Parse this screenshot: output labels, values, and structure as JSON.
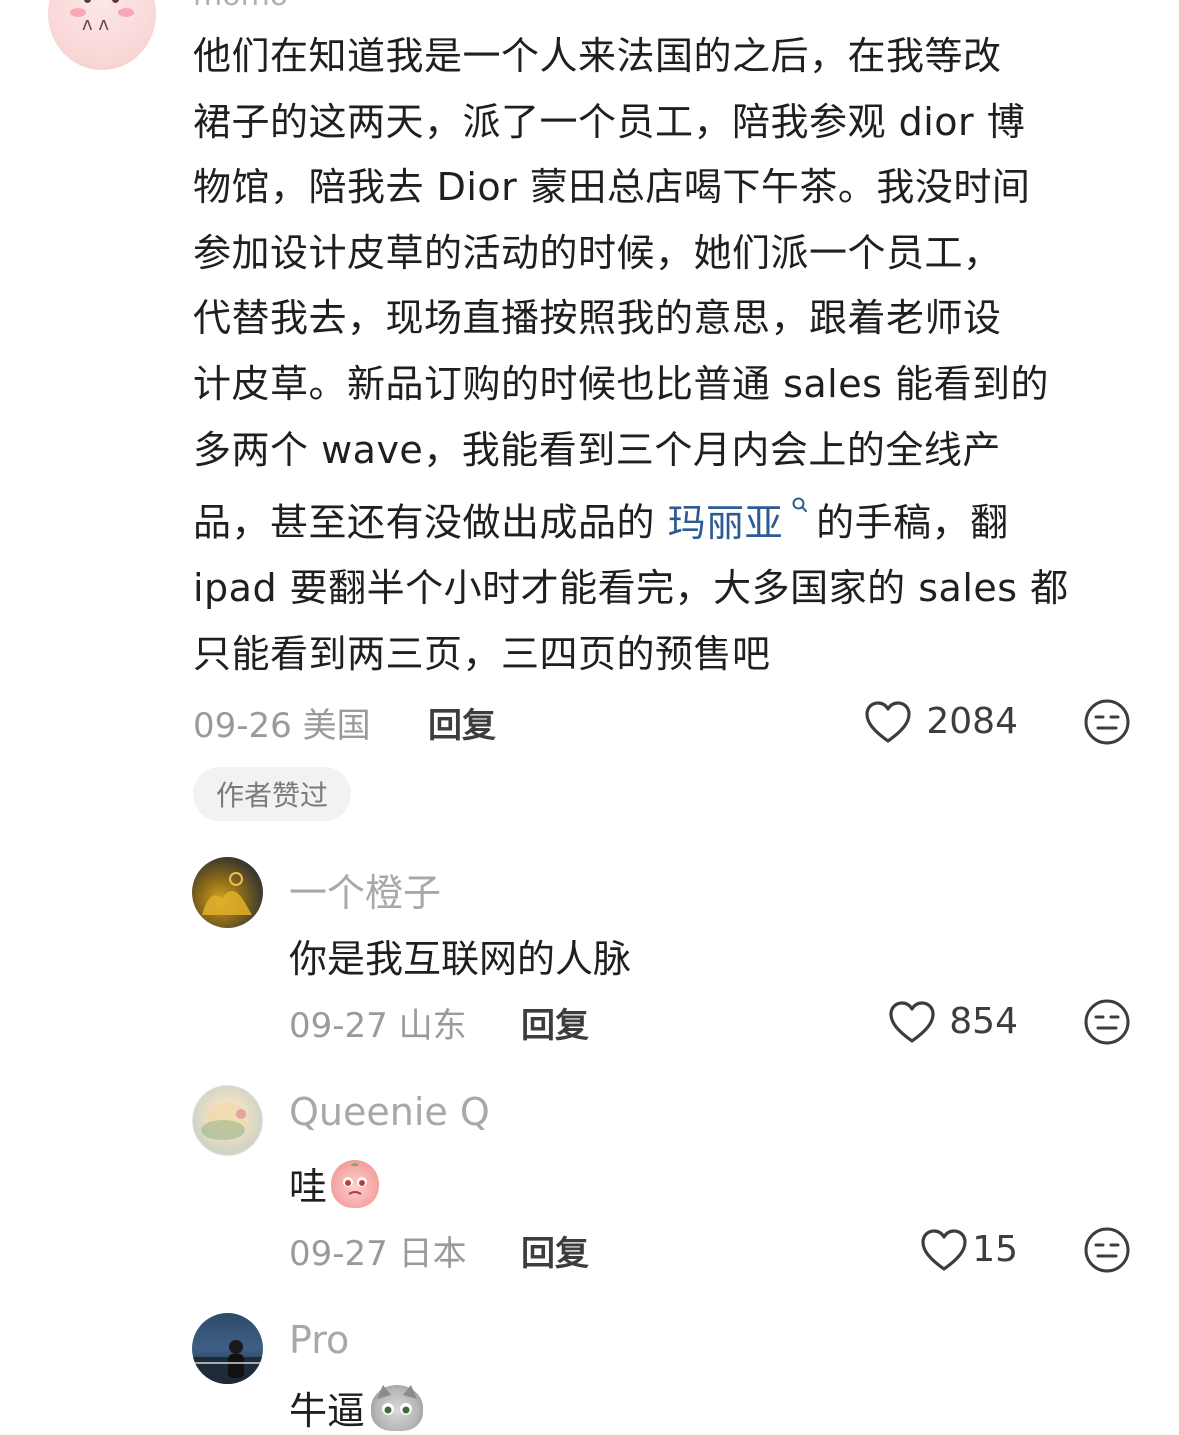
{
  "main_comment": {
    "username": "momo",
    "text_lines": [
      "他们在知道我是一个人来法国的之后，在我等改",
      "裙子的这两天，派了一个员工，陪我参观 dior 博",
      "物馆，陪我去 Dior 蒙田总店喝下午茶。我没时间",
      "参加设计皮草的活动的时候，她们派一个员工，",
      "代替我去，现场直播按照我的意思，跟着老师设",
      "计皮草。新品订购的时候也比普通 sales 能看到的",
      "多两个 wave，我能看到三个月内会上的全线产"
    ],
    "line8_before": "品，甚至还有没做出成品的 ",
    "line8_tag": "玛丽亚",
    "line8_after": " 的手稿，翻",
    "text_lines_end": [
      "ipad 要翻半个小时才能看完，大多国家的 sales 都",
      "只能看到两三页，三四页的预售吧"
    ],
    "date_location": "09-26 美国",
    "reply_label": "回复",
    "like_count": "2084",
    "author_liked_badge": "作者赞过"
  },
  "replies": [
    {
      "username": "一个橙子",
      "text": "你是我互联网的人脉",
      "date_location": "09-27 山东",
      "reply_label": "回复",
      "like_count": "854"
    },
    {
      "username": "Queenie Q",
      "text": "哇",
      "emoji": "peach-emoji",
      "date_location": "09-27 日本",
      "reply_label": "回复",
      "like_count": "15"
    },
    {
      "username": "Pro",
      "text": "牛逼",
      "emoji": "cat-emoji"
    }
  ],
  "icons": {
    "like": "heart-outline-icon",
    "dislike": "meh-face-icon",
    "tag": "search-icon"
  },
  "colors": {
    "tag_link": "#2d5b93",
    "meta_gray": "#9a9a9a",
    "badge_bg": "#f2f2f2"
  }
}
